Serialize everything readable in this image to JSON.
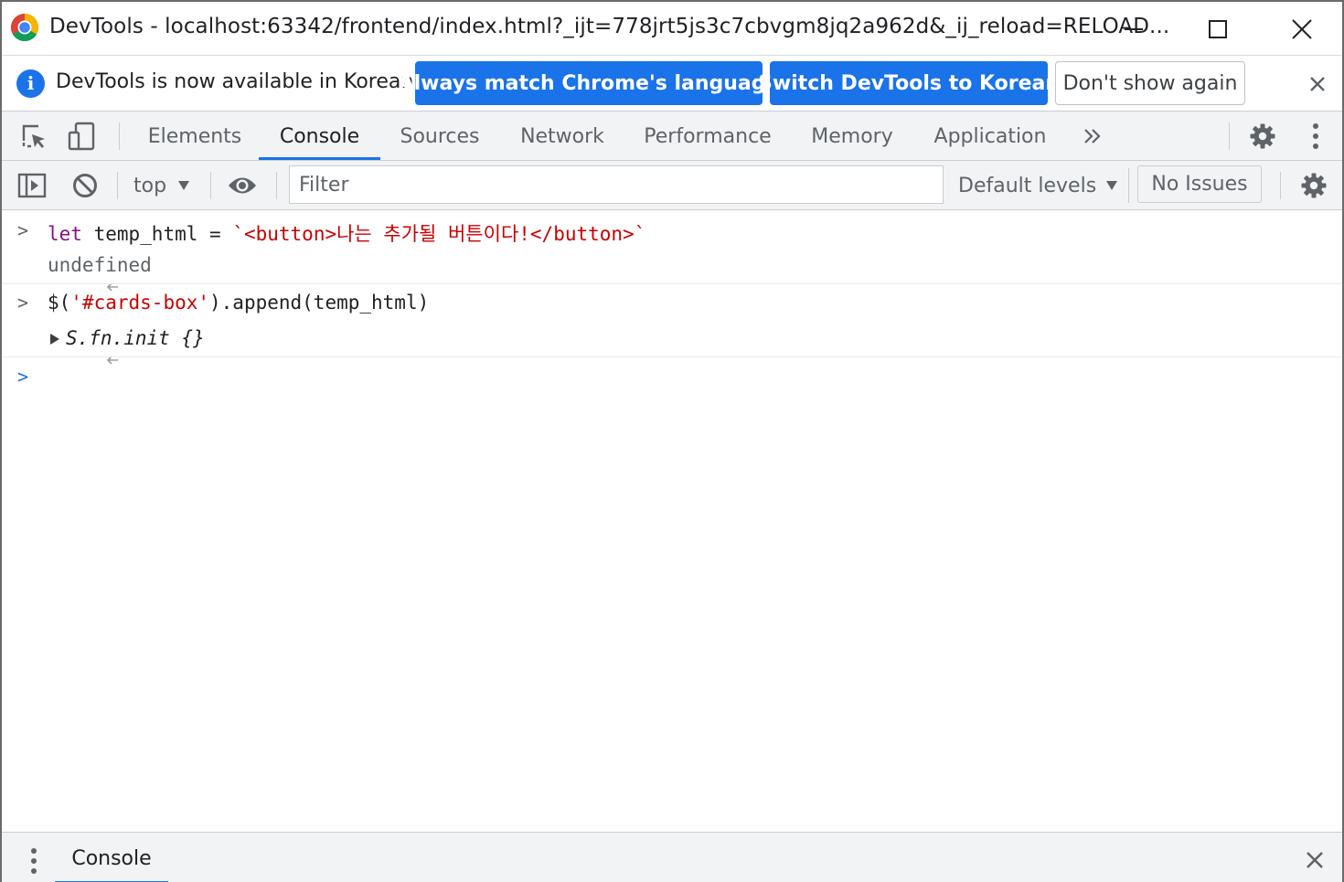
{
  "window": {
    "title": "DevTools  -  localhost:63342/frontend/index.html?_ijt=778jrt5js3c7cbvgm8jq2a962d&_ij_reload=RELOAD..."
  },
  "infobar": {
    "message": "DevTools is now available in Korean!",
    "buttons": {
      "match_language": "Always match Chrome's language",
      "switch_korean": "Switch DevTools to Korean",
      "dont_show": "Don't show again"
    }
  },
  "tabs": [
    {
      "label": "Elements"
    },
    {
      "label": "Console"
    },
    {
      "label": "Sources"
    },
    {
      "label": "Network"
    },
    {
      "label": "Performance"
    },
    {
      "label": "Memory"
    },
    {
      "label": "Application"
    }
  ],
  "active_tab": "Console",
  "console_toolbar": {
    "context": "top",
    "filter_placeholder": "Filter",
    "levels": "Default levels",
    "issues": "No Issues"
  },
  "console": {
    "lines": [
      {
        "type": "input",
        "kw": "let",
        "mid": " temp_html = ",
        "str": "`<button>나는 추가될 버튼이다!</button>`"
      },
      {
        "type": "output",
        "text": "undefined"
      },
      {
        "type": "input",
        "pre": "$(",
        "str": "'#cards-box'",
        "post": ").append(temp_html)"
      },
      {
        "type": "output",
        "text": "S.fn.init {}"
      }
    ]
  },
  "drawer": {
    "tab": "Console"
  },
  "colors": {
    "accent": "#1a73e8",
    "keyword": "#881280",
    "string": "#c80000",
    "toolbar_bg": "#f1f3f4"
  }
}
